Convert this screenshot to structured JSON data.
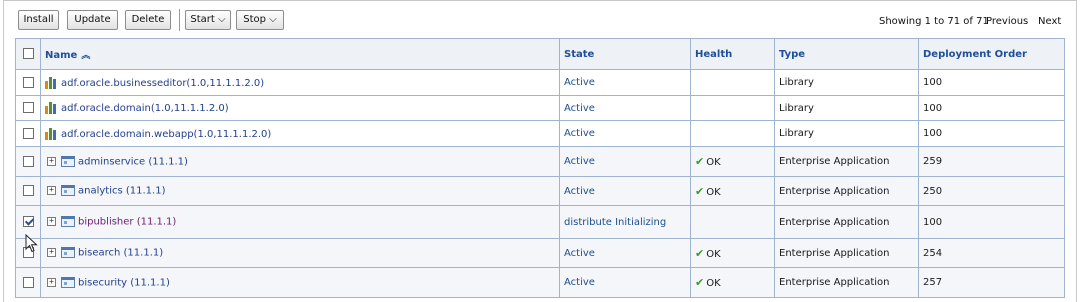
{
  "toolbar": {
    "install_label": "Install",
    "update_label": "Update",
    "delete_label": "Delete",
    "start_label": "Start",
    "stop_label": "Stop",
    "dropdown_glyph": "⌵"
  },
  "pager": {
    "showing_text": "Showing 1 to 71 of 71",
    "previous_label": "Previous",
    "next_label": "Next"
  },
  "table": {
    "headers": {
      "name": "Name",
      "state": "State",
      "health": "Health",
      "type": "Type",
      "deployment_order": "Deployment Order"
    },
    "sort_icon": "sort-ascending-icon",
    "rows": [
      {
        "name": "adf.oracle.businesseditor(1.0,11.1.1.2.0)",
        "state": "Active",
        "health": "",
        "type": "Library",
        "order": "100",
        "checked": false,
        "kind": "library"
      },
      {
        "name": "adf.oracle.domain(1.0,11.1.1.2.0)",
        "state": "Active",
        "health": "",
        "type": "Library",
        "order": "100",
        "checked": false,
        "kind": "library"
      },
      {
        "name": "adf.oracle.domain.webapp(1.0,11.1.1.2.0)",
        "state": "Active",
        "health": "",
        "type": "Library",
        "order": "100",
        "checked": false,
        "kind": "library"
      },
      {
        "name": "adminservice (11.1.1)",
        "state": "Active",
        "health": "OK",
        "type": "Enterprise Application",
        "order": "259",
        "checked": false,
        "kind": "app"
      },
      {
        "name": "analytics (11.1.1)",
        "state": "Active",
        "health": "OK",
        "type": "Enterprise Application",
        "order": "250",
        "checked": false,
        "kind": "app"
      },
      {
        "name": "bipublisher (11.1.1)",
        "state": "distribute Initializing",
        "health": "",
        "type": "Enterprise Application",
        "order": "100",
        "checked": true,
        "kind": "app"
      },
      {
        "name": "bisearch (11.1.1)",
        "state": "Active",
        "health": "OK",
        "type": "Enterprise Application",
        "order": "254",
        "checked": false,
        "kind": "app"
      },
      {
        "name": "bisecurity (11.1.1)",
        "state": "Active",
        "health": "OK",
        "type": "Enterprise Application",
        "order": "257",
        "checked": false,
        "kind": "app"
      }
    ]
  },
  "colors": {
    "header_text": "#1f4e9a",
    "link": "#23408e",
    "link_visited": "#6e1c73",
    "ok_check": "#3a9a2a",
    "grid_border": "#9fb5cf"
  }
}
